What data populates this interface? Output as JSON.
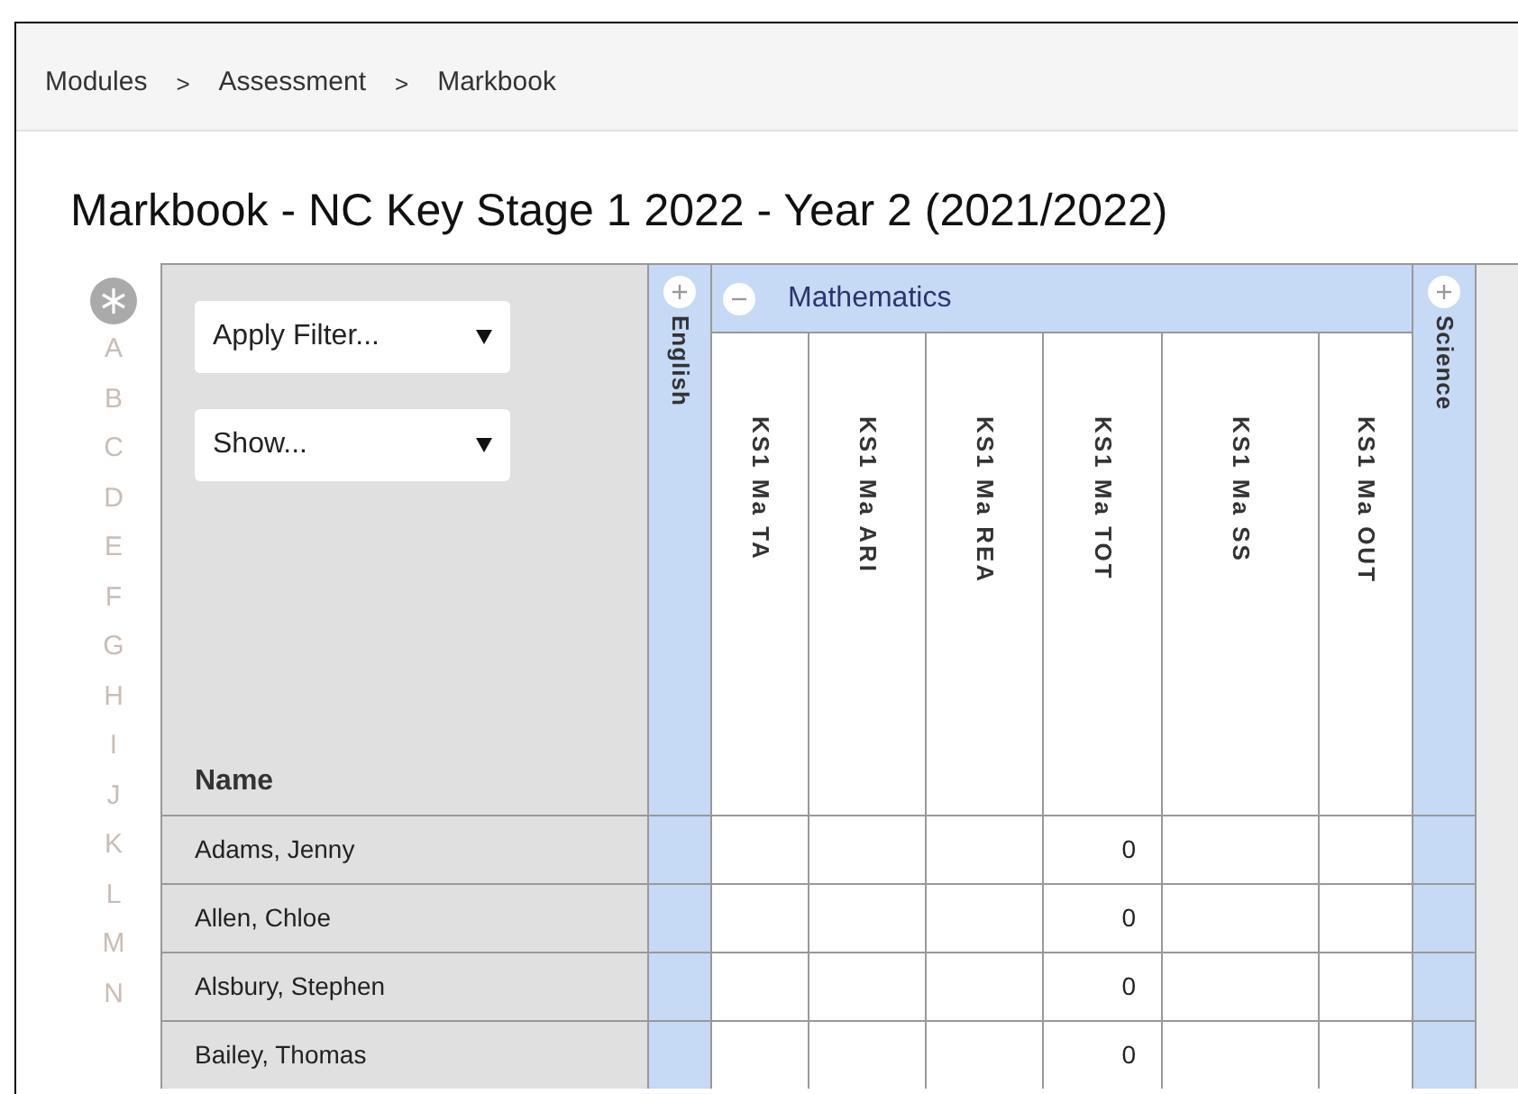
{
  "breadcrumb": {
    "items": [
      "Modules",
      "Assessment",
      "Markbook"
    ],
    "separator": ">"
  },
  "title": "Markbook - NC Key Stage 1 2022 - Year 2 (2021/2022)",
  "index_letters": [
    "A",
    "B",
    "C",
    "D",
    "E",
    "F",
    "G",
    "H",
    "I",
    "J",
    "K",
    "L",
    "M",
    "N"
  ],
  "filters": [
    {
      "label": "Apply Filter..."
    },
    {
      "label": "Show..."
    }
  ],
  "name_header": "Name",
  "groups": [
    {
      "name": "English",
      "expanded": false
    },
    {
      "name": "Mathematics",
      "expanded": true,
      "columns": [
        {
          "label": "KS1 Ma TA"
        },
        {
          "label": "KS1 Ma ARI"
        },
        {
          "label": "KS1 Ma REA"
        },
        {
          "label": "KS1 Ma TOT",
          "values": [
            "0",
            "0",
            "0",
            "0"
          ]
        },
        {
          "label": "KS1 Ma SS"
        },
        {
          "label": "KS1 Ma OUT"
        }
      ]
    },
    {
      "name": "Science",
      "expanded": false
    }
  ],
  "rows": [
    {
      "name": "Adams, Jenny"
    },
    {
      "name": "Allen, Chloe"
    },
    {
      "name": "Alsbury, Stephen"
    },
    {
      "name": "Bailey, Thomas"
    }
  ]
}
